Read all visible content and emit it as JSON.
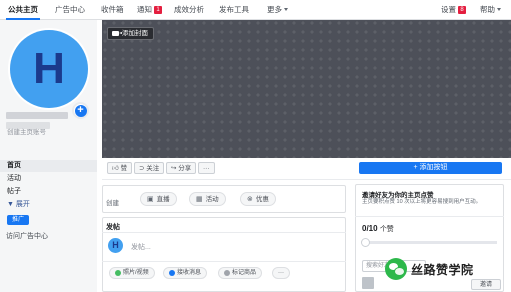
{
  "topnav": {
    "items": [
      {
        "label": "公共主页",
        "active": true
      },
      {
        "label": "广告中心"
      },
      {
        "label": "收件箱"
      },
      {
        "label": "通知",
        "badge": "1"
      },
      {
        "label": "成效分析"
      },
      {
        "label": "发布工具"
      },
      {
        "label": "更多"
      }
    ],
    "settings_label": "设置",
    "settings_badge": "8",
    "help_label": "帮助"
  },
  "profile": {
    "letter": "H",
    "create_handle": "创建主页账号"
  },
  "sidebar": {
    "items": [
      {
        "label": "首页",
        "active": true
      },
      {
        "label": "活动"
      },
      {
        "label": "帖子"
      },
      {
        "label": "▼ 展开"
      }
    ],
    "promote_label": "推广",
    "visit_ads_label": "访问广告中心"
  },
  "cover": {
    "add_cover_label": "添加封面",
    "camera_icon": "camera-icon"
  },
  "actionbar": {
    "like_label": "赞",
    "follow_label": "关注",
    "share_label": "分享",
    "more_label": "···",
    "add_button_label": "+ 添加按钮"
  },
  "create": {
    "label": "创建",
    "live_label": "直播",
    "event_label": "活动",
    "offer_label": "优惠"
  },
  "post": {
    "title": "发帖",
    "avatar_letter": "H",
    "placeholder": "发帖...",
    "photo_video_label": "照片/视频",
    "messages_label": "接收消息",
    "tag_products_label": "标记商品",
    "more_label": "···"
  },
  "invite": {
    "title": "邀请好友为你的主页点赞",
    "description": "主页要积点赞 10 次以上将更容易搜到用户互动。",
    "count": "0/10",
    "count_unit": "个赞",
    "progress": 0,
    "search_placeholder": "搜索好友邀请",
    "invite_button": "邀请"
  },
  "watermark": {
    "text": "丝路赞学院"
  },
  "colors": {
    "accent": "#1877f2",
    "avatar_bg": "#42a0f0",
    "avatar_letter": "#1b3a8c",
    "cover_bg": "#4d5059",
    "badge": "#e41e3f"
  }
}
